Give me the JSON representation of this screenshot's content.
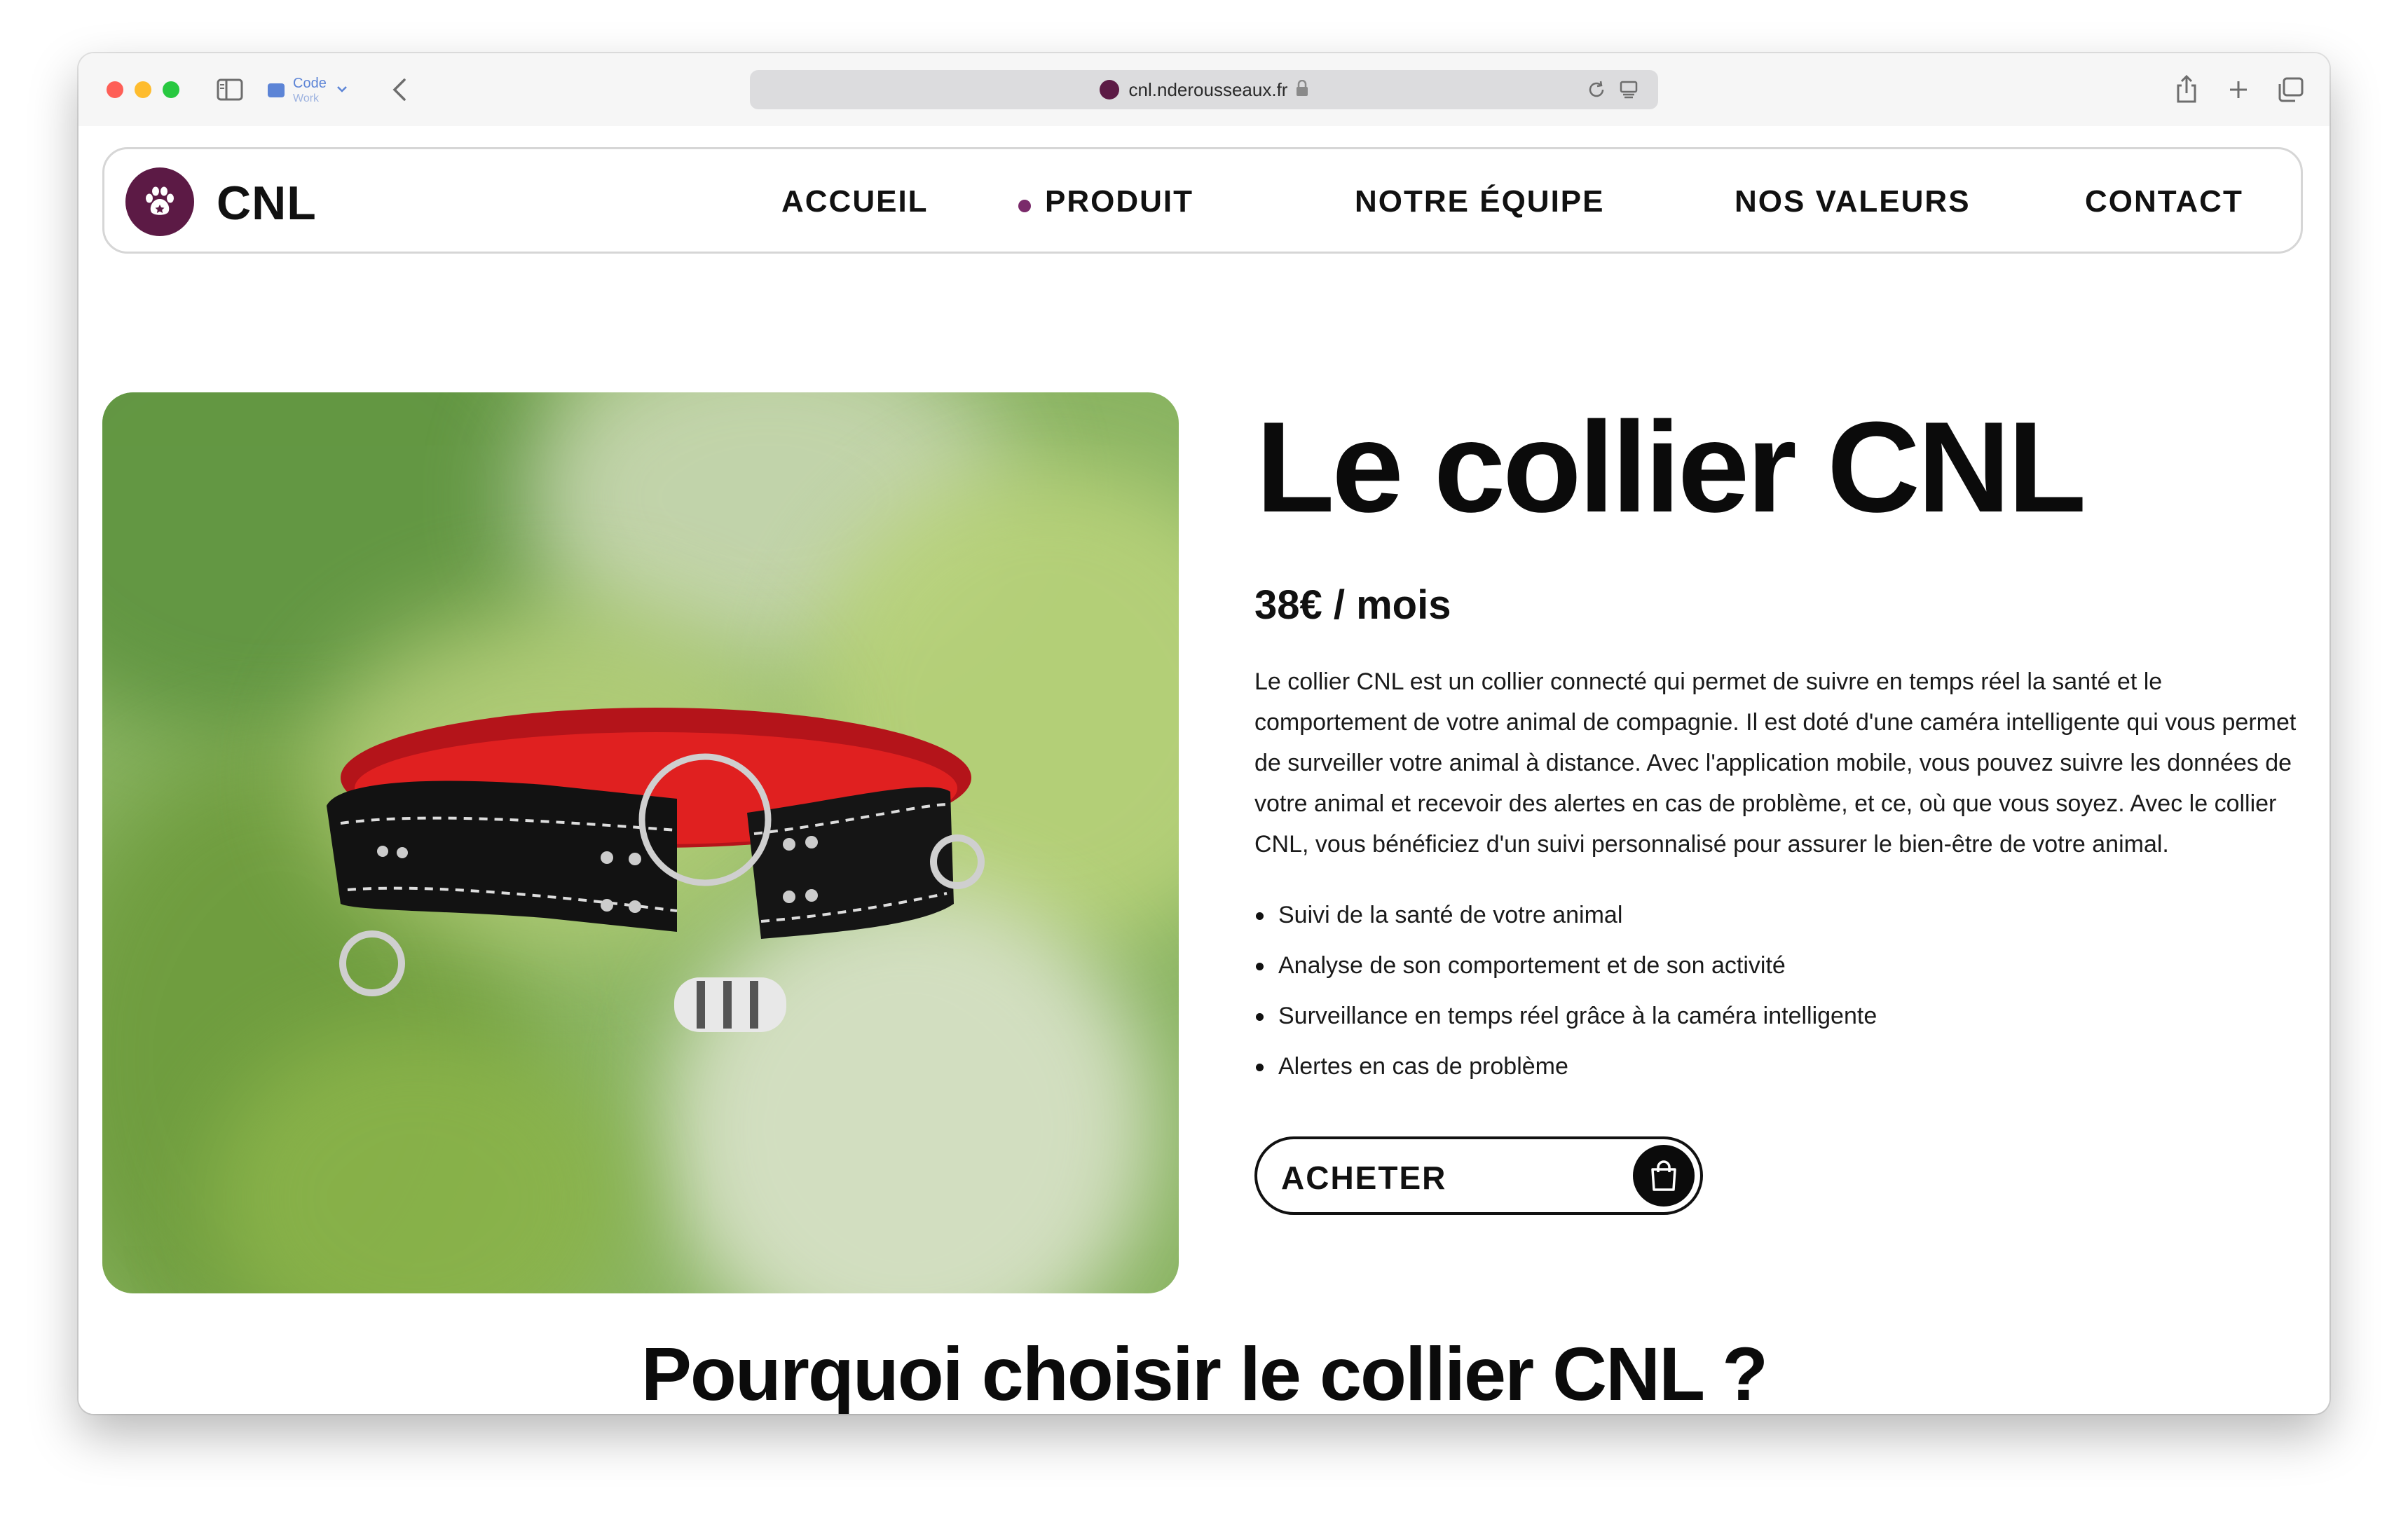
{
  "browser": {
    "tab_group_name": "Code",
    "tab_group_sub": "Work",
    "url": "cnl.nderousseaux.fr"
  },
  "nav": {
    "brand": "CNL",
    "items": [
      {
        "label": "ACCUEIL",
        "active": false
      },
      {
        "label": "PRODUIT",
        "active": true
      },
      {
        "label": "NOTRE ÉQUIPE",
        "active": false
      },
      {
        "label": "NOS VALEURS",
        "active": false
      },
      {
        "label": "CONTACT",
        "active": false
      }
    ]
  },
  "product": {
    "title": "Le collier CNL",
    "price": "38€ / mois",
    "description": "Le collier CNL est un collier connecté qui permet de suivre en temps réel la santé et le comportement de votre animal de compagnie. Il est doté d'une caméra intelligente qui vous permet de surveiller votre animal à distance. Avec l'application mobile, vous pouvez suivre les données de votre animal et recevoir des alertes en cas de problème, et ce, où que vous soyez. Avec le collier CNL, vous bénéficiez d'un suivi personnalisé pour assurer le bien-être de votre animal.",
    "features": [
      "Suivi de la santé de votre animal",
      "Analyse de son comportement et de son activité",
      "Surveillance en temps réel grâce à la caméra intelligente",
      "Alertes en cas de problème"
    ],
    "buy_label": "ACHETER",
    "image_icon": "collar-image"
  },
  "section": {
    "title": "Pourquoi choisir le collier CNL ?"
  },
  "colors": {
    "brand": "#5c1a45",
    "accent_dot": "#7a2a6a",
    "text": "#111111"
  }
}
